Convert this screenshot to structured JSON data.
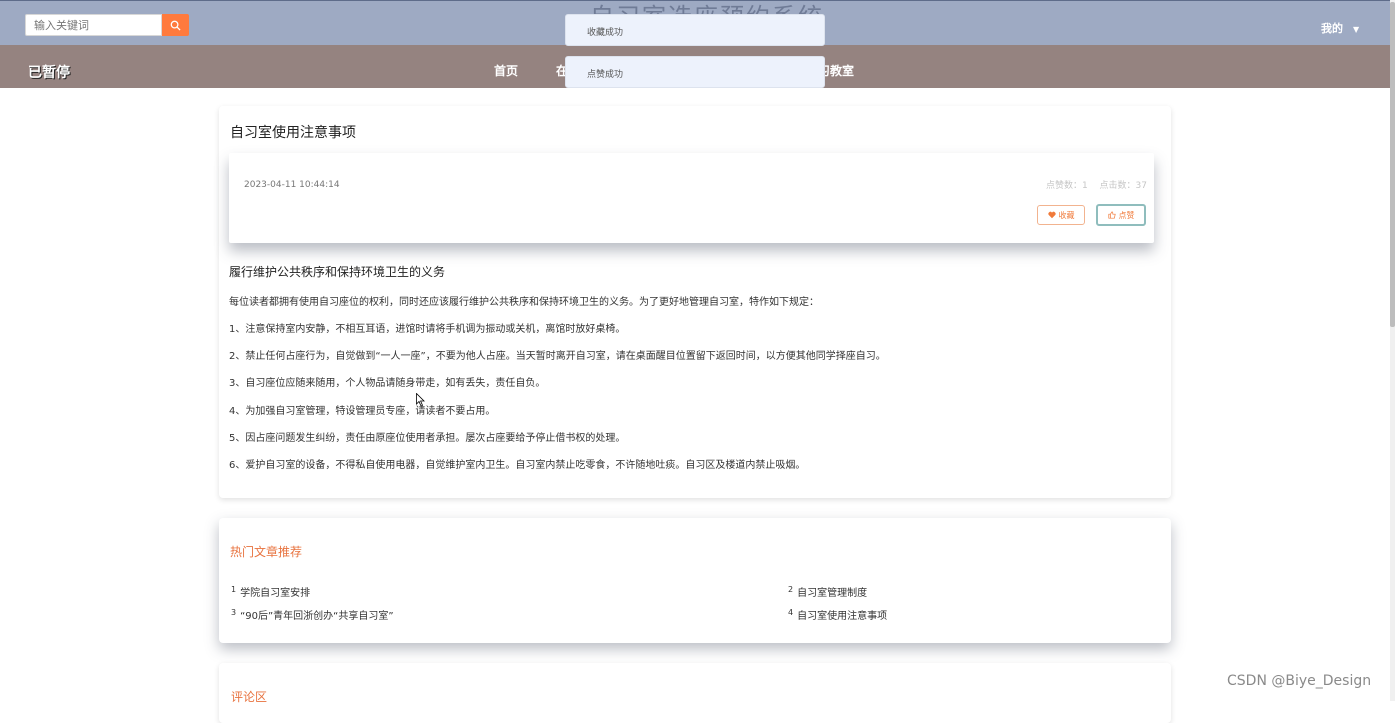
{
  "header": {
    "search_placeholder": "输入关键词",
    "site_title_partial": "自习室选座预约系统",
    "user_menu": "我的"
  },
  "nav": {
    "brand": "已暂停",
    "items": [
      {
        "label": "首页"
      },
      {
        "label": "在"
      },
      {
        "label": "习教室"
      }
    ]
  },
  "toasts": [
    {
      "text": "收藏成功"
    },
    {
      "text": "点赞成功"
    }
  ],
  "article": {
    "title": "自习室使用注意事项",
    "date": "2023-04-11 10:44:14",
    "likes": "点赞数：1",
    "clicks": "点击数：37",
    "favorite_label": "收藏",
    "like_label": "点赞",
    "subheading": "履行维护公共秩序和保持环境卫生的义务",
    "paragraphs": [
      "每位读者都拥有使用自习座位的权利，同时还应该履行维护公共秩序和保持环境卫生的义务。为了更好地管理自习室，特作如下规定：",
      "1、注意保持室内安静，不相互耳语，进馆时请将手机调为振动或关机，离馆时放好桌椅。",
      "2、禁止任何占座行为，自觉做到“一人一座”，不要为他人占座。当天暂时离开自习室，请在桌面醒目位置留下返回时间，以方便其他同学择座自习。",
      "3、自习座位应随来随用，个人物品请随身带走，如有丢失，责任自负。",
      "4、为加强自习室管理，特设管理员专座，请读者不要占用。",
      "5、因占座问题发生纠纷，责任由原座位使用者承担。屡次占座要给予停止借书权的处理。",
      "6、爱护自习室的设备，不得私自使用电器，自觉维护室内卫生。自习室内禁止吃零食，不许随地吐痰。自习区及楼道内禁止吸烟。"
    ]
  },
  "hot": {
    "title": "热门文章推荐",
    "items": [
      {
        "rank": "1",
        "label": "学院自习室安排"
      },
      {
        "rank": "2",
        "label": "自习室管理制度"
      },
      {
        "rank": "3",
        "label": "“90后”青年回浙创办“共享自习室”"
      },
      {
        "rank": "4",
        "label": "自习室使用注意事项"
      }
    ]
  },
  "comments": {
    "title": "评论区"
  },
  "watermark": "CSDN @Biye_Design",
  "colors": {
    "topbar": "#9eaac3",
    "navbar": "#958380",
    "accent": "#ff7a3d",
    "hot_title": "#e8733f"
  }
}
